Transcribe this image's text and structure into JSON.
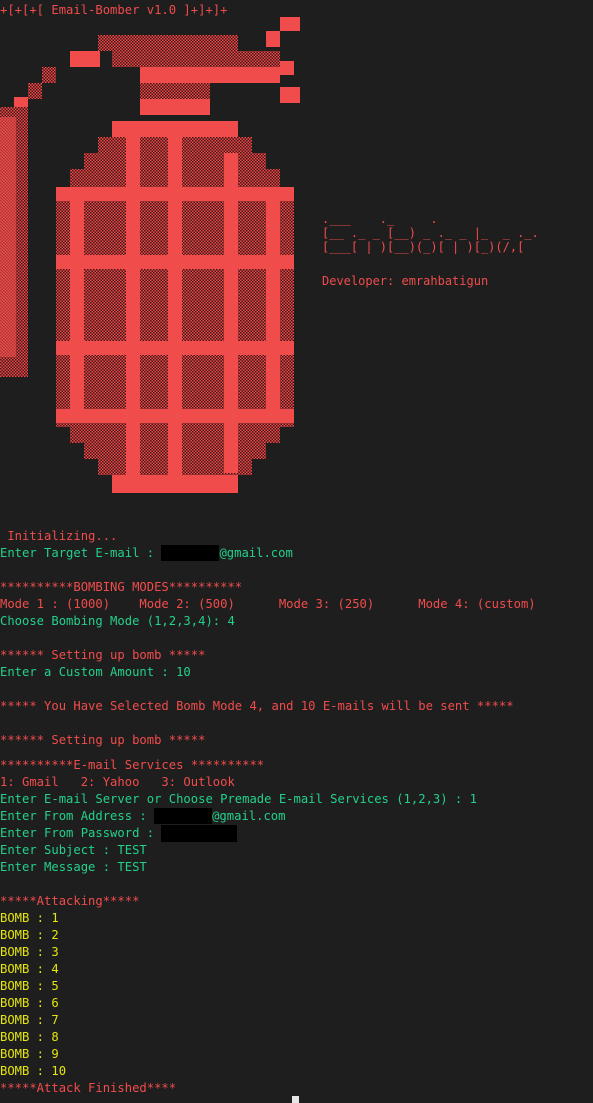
{
  "terminal": {
    "title_line": "+[+[+[ Email-Bomber v1.0 ]+]+]+",
    "banner": {
      "line1": ".___    ._     .",
      "line2": "[__ ._ _ [__) _ ._ _ |_  _ ._.",
      "line3": "[___[ | )[__)(_)[ | )[_)(/,[",
      "developer": "Developer: emrahbatigun"
    },
    "initializing": " Initializing...",
    "target_prompt": "Enter Target E-mail : ",
    "target_suffix": "@gmail.com",
    "modes_header": "**********BOMBING MODES**********",
    "modes_line": "Mode 1 : (1000)    Mode 2: (500)      Mode 3: (250)      Mode 4: (custom)",
    "choose_mode": "Choose Bombing Mode (1,2,3,4): 4",
    "setup_1": "****** Setting up bomb *****",
    "custom_amount": "Enter a Custom Amount : 10",
    "selected_msg": "***** You Have Selected Bomb Mode 4, and 10 E-mails will be sent *****",
    "setup_2": "****** Setting up bomb *****",
    "services_header": "**********E-mail Services **********",
    "services_list": "1: Gmail   2: Yahoo   3: Outlook",
    "server_choice": "Enter E-mail Server or Choose Premade E-mail Services (1,2,3) : 1",
    "from_prompt": "Enter From Address : ",
    "from_suffix": "@gmail.com",
    "password_prompt": "Enter From Password : ",
    "subject": "Enter Subject : TEST",
    "message": "Enter Message : TEST",
    "attacking": "*****Attacking*****",
    "bombs": [
      "BOMB : 1",
      "BOMB : 2",
      "BOMB : 3",
      "BOMB : 4",
      "BOMB : 5",
      "BOMB : 6",
      "BOMB : 7",
      "BOMB : 8",
      "BOMB : 9",
      "BOMB : 10"
    ],
    "finished": "*****Attack Finished****"
  },
  "colors": {
    "background": "#1e1e1e",
    "red": "#f14c4c",
    "green": "#23d18b",
    "yellow": "#e5e510",
    "grenade_fill": "#f14c4c",
    "grenade_shade": "#8c2a2a"
  }
}
